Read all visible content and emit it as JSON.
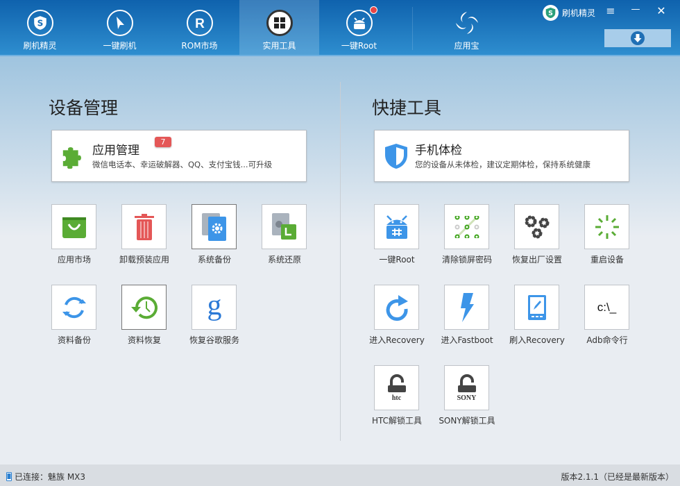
{
  "nav": [
    {
      "label": "刷机精灵",
      "icon": "shield-s-icon",
      "active": false
    },
    {
      "label": "一键刷机",
      "icon": "cursor-icon",
      "active": false
    },
    {
      "label": "ROM市场",
      "icon": "rom-r-icon",
      "active": false
    },
    {
      "label": "实用工具",
      "icon": "grid-icon",
      "active": true
    },
    {
      "label": "一键Root",
      "icon": "android-icon",
      "active": false,
      "dot": true
    },
    {
      "label": "应用宝",
      "icon": "yingyongbao-icon",
      "active": false
    }
  ],
  "window": {
    "brand": "刷机精灵",
    "menu": "≡",
    "minimize": "—",
    "close": "✕"
  },
  "left": {
    "title": "设备管理",
    "card": {
      "title": "应用管理",
      "badge": "7",
      "subtitle": "微信电话本、幸运破解器、QQ、支付宝钱...可升级"
    },
    "tiles": [
      {
        "label": "应用市场",
        "icon": "shopping-bag-icon"
      },
      {
        "label": "卸载预装应用",
        "icon": "trash-icon"
      },
      {
        "label": "系统备份",
        "icon": "system-backup-icon",
        "selected": true
      },
      {
        "label": "系统还原",
        "icon": "system-restore-icon"
      },
      {
        "label": "资料备份",
        "icon": "sync-icon"
      },
      {
        "label": "资料恢复",
        "icon": "history-icon",
        "selected": true
      },
      {
        "label": "恢复谷歌服务",
        "icon": "google-icon"
      }
    ]
  },
  "right": {
    "title": "快捷工具",
    "card": {
      "title": "手机体检",
      "subtitle": "您的设备从未体检，建议定期体检，保持系统健康"
    },
    "tiles": [
      {
        "label": "一键Root",
        "icon": "android-root-icon"
      },
      {
        "label": "清除锁屏密码",
        "icon": "pattern-lock-icon"
      },
      {
        "label": "恢复出厂设置",
        "icon": "gears-icon"
      },
      {
        "label": "重启设备",
        "icon": "reboot-spinner-icon"
      },
      {
        "label": "进入Recovery",
        "icon": "refresh-icon"
      },
      {
        "label": "进入Fastboot",
        "icon": "lightning-icon"
      },
      {
        "label": "刷入Recovery",
        "icon": "tablet-edit-icon"
      },
      {
        "label": "Adb命令行",
        "icon": "terminal-icon",
        "text": "c:\\_"
      },
      {
        "label": "HTC解锁工具",
        "icon": "htc-unlock-icon",
        "text": "htc"
      },
      {
        "label": "SONY解锁工具",
        "icon": "sony-unlock-icon",
        "text": "SONY"
      }
    ]
  },
  "status": {
    "connection": "已连接：魅族 MX3",
    "version": "版本2.1.1（已经是最新版本）"
  },
  "colors": {
    "topbar": "#1a6fb8",
    "green": "#5aac35",
    "blue": "#3d95e8",
    "red": "#e45757"
  }
}
